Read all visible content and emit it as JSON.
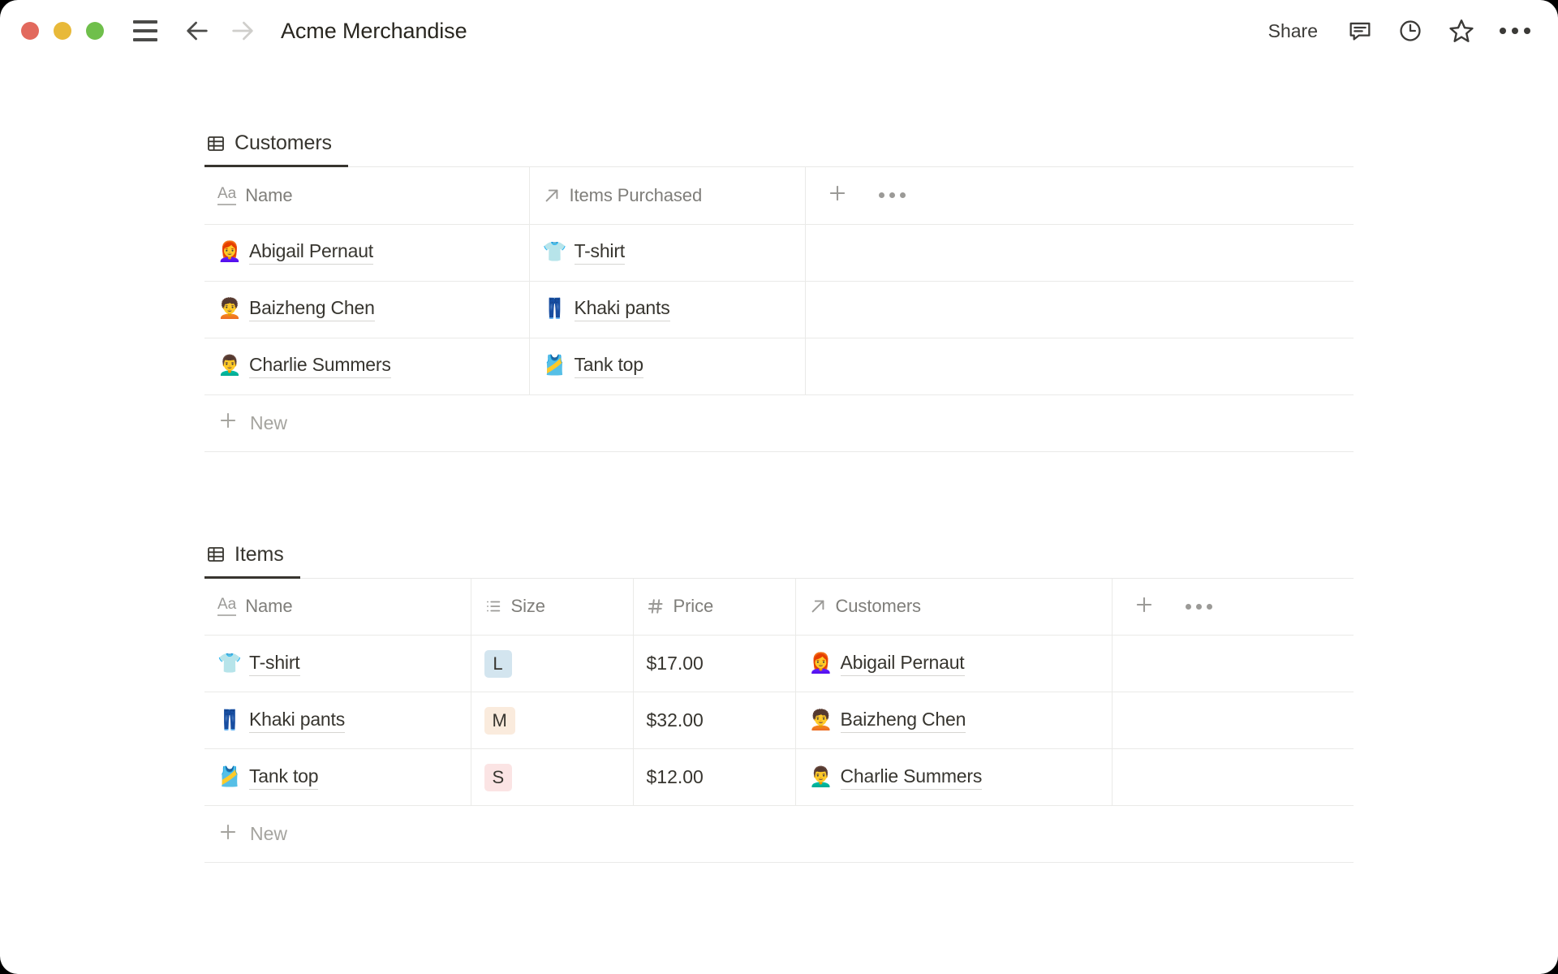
{
  "window": {
    "title": "Acme Merchandise",
    "traffic_lights": [
      "close",
      "minimize",
      "maximize"
    ],
    "nav": {
      "back": "back-arrow",
      "forward": "forward-arrow",
      "menu": "hamburger-menu"
    },
    "actions": {
      "share_label": "Share",
      "icons": [
        "comment-icon",
        "history-clock-icon",
        "star-icon",
        "more-options-icon"
      ]
    }
  },
  "databases": [
    {
      "id": "customers",
      "tab_label": "Customers",
      "tab_icon": "table-icon",
      "columns": [
        {
          "label": "Name",
          "type_icon": "text-aa-icon"
        },
        {
          "label": "Items Purchased",
          "type_icon": "relation-arrow-icon"
        }
      ],
      "header_tools": {
        "add": "+",
        "more": "more-options-icon"
      },
      "rows": [
        {
          "name_emoji": "👩‍🦰",
          "name": "Abigail Pernaut",
          "item_emoji": "👕",
          "item": "T-shirt"
        },
        {
          "name_emoji": "🧑‍🦱",
          "name": "Baizheng Chen",
          "item_emoji": "👖",
          "item": "Khaki pants"
        },
        {
          "name_emoji": "👨‍🦱",
          "name": "Charlie Summers",
          "item_emoji": "🎽",
          "item": "Tank top"
        }
      ],
      "new_row_label": "New"
    },
    {
      "id": "items",
      "tab_label": "Items",
      "tab_icon": "table-icon",
      "columns": [
        {
          "label": "Name",
          "type_icon": "text-aa-icon"
        },
        {
          "label": "Size",
          "type_icon": "select-list-icon"
        },
        {
          "label": "Price",
          "type_icon": "number-hash-icon"
        },
        {
          "label": "Customers",
          "type_icon": "relation-arrow-icon"
        }
      ],
      "header_tools": {
        "add": "+",
        "more": "more-options-icon"
      },
      "rows": [
        {
          "item_emoji": "👕",
          "name": "T-shirt",
          "size": "L",
          "size_color": "#d3e5ef",
          "price": "$17.00",
          "customer_emoji": "👩‍🦰",
          "customer": "Abigail Pernaut"
        },
        {
          "item_emoji": "👖",
          "name": "Khaki pants",
          "size": "M",
          "size_color": "#faebdd",
          "price": "$32.00",
          "customer_emoji": "🧑‍🦱",
          "customer": "Baizheng Chen"
        },
        {
          "item_emoji": "🎽",
          "name": "Tank top",
          "size": "S",
          "size_color": "#fbe4e4",
          "price": "$12.00",
          "customer_emoji": "👨‍🦱",
          "customer": "Charlie Summers"
        }
      ],
      "new_row_label": "New"
    }
  ],
  "colors": {
    "text": "#37352f",
    "muted": "#9b9a97",
    "border": "#eaeae8",
    "accent_underline": "#37352f"
  }
}
